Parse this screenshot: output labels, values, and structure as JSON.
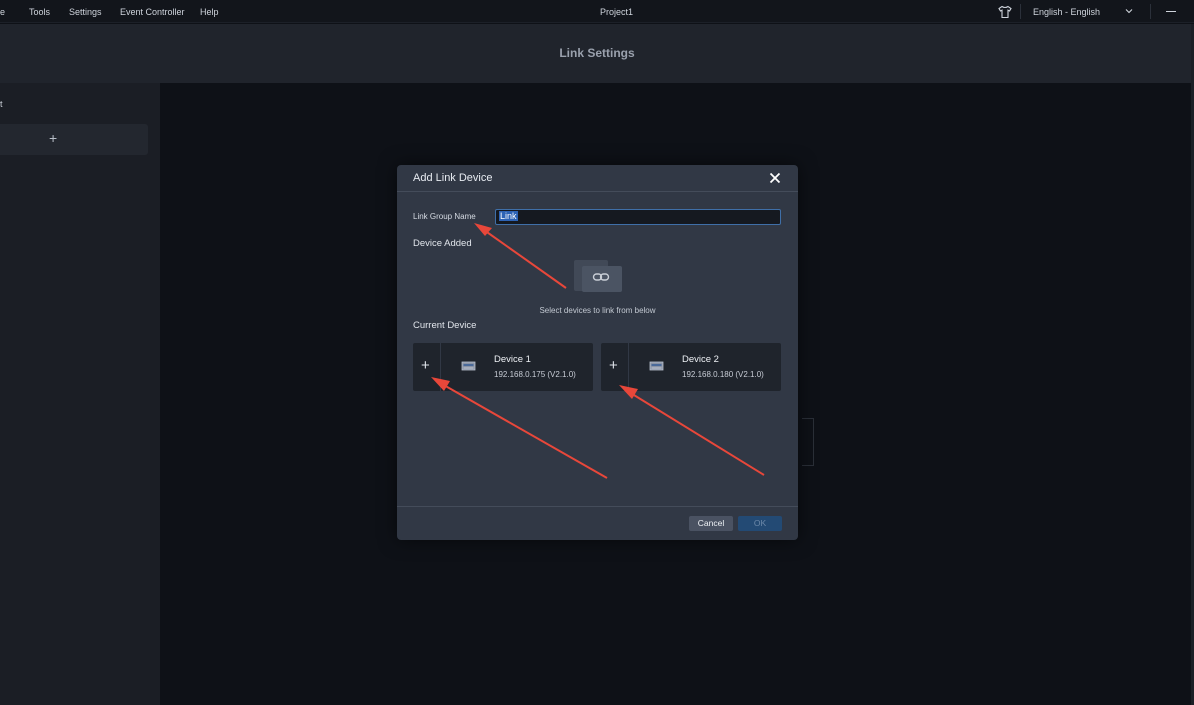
{
  "menubar": {
    "items": [
      "e",
      "Tools",
      "Settings",
      "Event Controller",
      "Help"
    ],
    "project_title": "Project1",
    "language": "English - English",
    "icons": [
      "shirt-icon",
      "chevron-down-icon",
      "minimize-icon"
    ]
  },
  "header": {
    "title": "Link Settings"
  },
  "left_panel": {
    "stub_text": "t",
    "add_label": "+"
  },
  "dialog": {
    "title": "Add Link Device",
    "group_name_label": "Link Group Name",
    "group_name_value": "Link",
    "device_added_label": "Device Added",
    "empty_hint": "Select devices to link from below",
    "current_device_label": "Current Device",
    "devices": [
      {
        "name": "Device 1",
        "ip": "192.168.0.175 (V2.1.0)"
      },
      {
        "name": "Device 2",
        "ip": "192.168.0.180 (V2.1.0)"
      }
    ],
    "cancel_label": "Cancel",
    "ok_label": "OK"
  },
  "colors": {
    "background": "#0e1117",
    "dialog": "#313845",
    "accent": "#2d63b5",
    "annotation": "#e8473a"
  }
}
